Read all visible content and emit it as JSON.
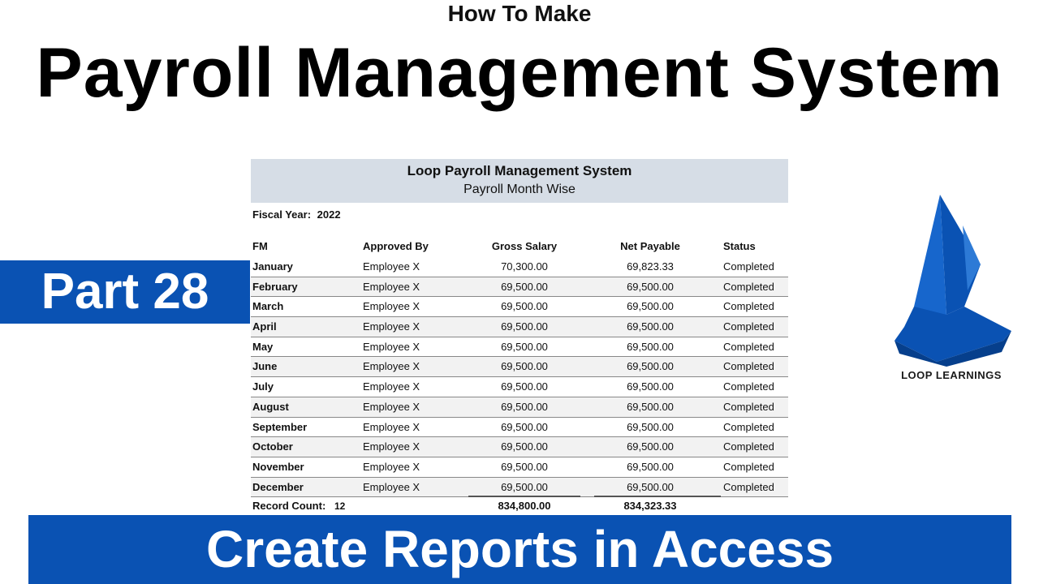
{
  "hero": {
    "kicker": "How To Make",
    "headline": "Payroll Management System",
    "part_label": "Part 28",
    "bottom_banner": "Create Reports in Access"
  },
  "brand": {
    "name": "LOOP LEARNINGS",
    "color": "#0a52b3"
  },
  "report": {
    "title": "Loop Payroll Management System",
    "subtitle": "Payroll Month Wise",
    "fiscal_year_label": "Fiscal Year:",
    "fiscal_year_value": "2022",
    "columns": {
      "fm": "FM",
      "approved_by": "Approved By",
      "gross_salary": "Gross Salary",
      "net_payable": "Net Payable",
      "status": "Status"
    },
    "rows": [
      {
        "fm": "January",
        "approved_by": "Employee X",
        "gross_salary": "70,300.00",
        "net_payable": "69,823.33",
        "status": "Completed"
      },
      {
        "fm": "February",
        "approved_by": "Employee X",
        "gross_salary": "69,500.00",
        "net_payable": "69,500.00",
        "status": "Completed"
      },
      {
        "fm": "March",
        "approved_by": "Employee X",
        "gross_salary": "69,500.00",
        "net_payable": "69,500.00",
        "status": "Completed"
      },
      {
        "fm": "April",
        "approved_by": "Employee X",
        "gross_salary": "69,500.00",
        "net_payable": "69,500.00",
        "status": "Completed"
      },
      {
        "fm": "May",
        "approved_by": "Employee X",
        "gross_salary": "69,500.00",
        "net_payable": "69,500.00",
        "status": "Completed"
      },
      {
        "fm": "June",
        "approved_by": "Employee X",
        "gross_salary": "69,500.00",
        "net_payable": "69,500.00",
        "status": "Completed"
      },
      {
        "fm": "July",
        "approved_by": "Employee X",
        "gross_salary": "69,500.00",
        "net_payable": "69,500.00",
        "status": "Completed"
      },
      {
        "fm": "August",
        "approved_by": "Employee X",
        "gross_salary": "69,500.00",
        "net_payable": "69,500.00",
        "status": "Completed"
      },
      {
        "fm": "September",
        "approved_by": "Employee X",
        "gross_salary": "69,500.00",
        "net_payable": "69,500.00",
        "status": "Completed"
      },
      {
        "fm": "October",
        "approved_by": "Employee X",
        "gross_salary": "69,500.00",
        "net_payable": "69,500.00",
        "status": "Completed"
      },
      {
        "fm": "November",
        "approved_by": "Employee X",
        "gross_salary": "69,500.00",
        "net_payable": "69,500.00",
        "status": "Completed"
      },
      {
        "fm": "December",
        "approved_by": "Employee X",
        "gross_salary": "69,500.00",
        "net_payable": "69,500.00",
        "status": "Completed"
      }
    ],
    "totals": {
      "record_count_label": "Record Count:",
      "record_count_value": "12",
      "gross_salary": "834,800.00",
      "net_payable": "834,323.33"
    }
  }
}
